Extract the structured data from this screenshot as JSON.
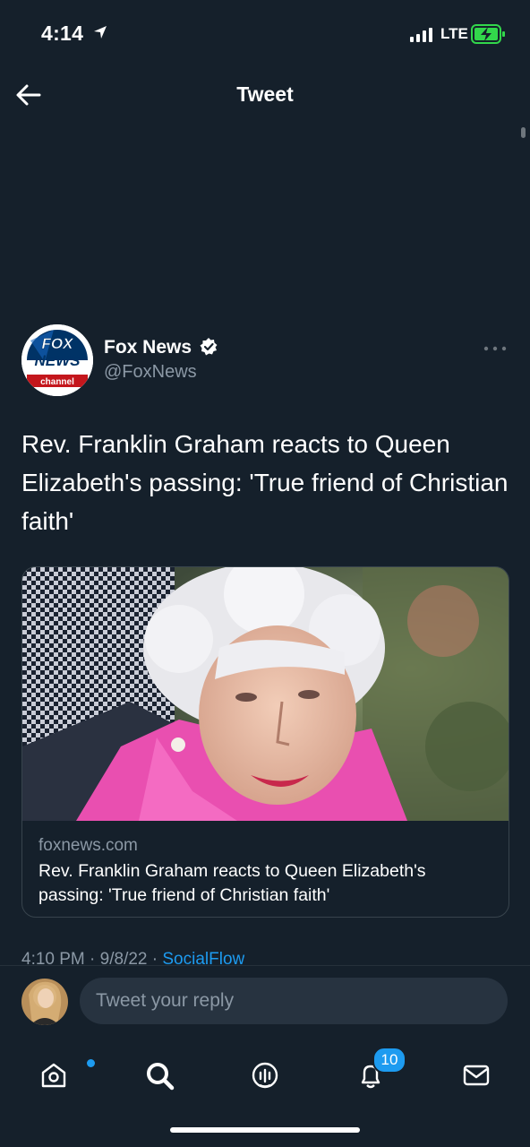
{
  "status_bar": {
    "time": "4:14",
    "carrier": "LTE"
  },
  "header": {
    "title": "Tweet"
  },
  "tweet": {
    "author_name": "Fox News",
    "author_handle": "@FoxNews",
    "text": "Rev. Franklin Graham reacts to Queen Elizabeth's passing: 'True friend of Christian faith'",
    "avatar_logo": {
      "line1": "FOX",
      "line2": "NEWS",
      "line3": "channel"
    },
    "card": {
      "domain": "foxnews.com",
      "title": "Rev. Franklin Graham reacts to Queen Elizabeth's passing: 'True friend of Christian faith'"
    },
    "meta": {
      "time": "4:10 PM",
      "date": "9/8/22",
      "source": "SocialFlow",
      "separator": "·"
    }
  },
  "reply": {
    "placeholder": "Tweet your reply"
  },
  "tab_bar": {
    "items": [
      {
        "name": "home",
        "icon": "home-icon"
      },
      {
        "name": "search",
        "icon": "search-icon"
      },
      {
        "name": "spaces",
        "icon": "spaces-icon"
      },
      {
        "name": "notifications",
        "icon": "bell-icon",
        "badge": "10"
      },
      {
        "name": "messages",
        "icon": "mail-icon"
      }
    ]
  },
  "colors": {
    "background": "#15202b",
    "accent": "#1d9bf0",
    "secondary_text": "#8b98a5",
    "border": "#38444d"
  }
}
